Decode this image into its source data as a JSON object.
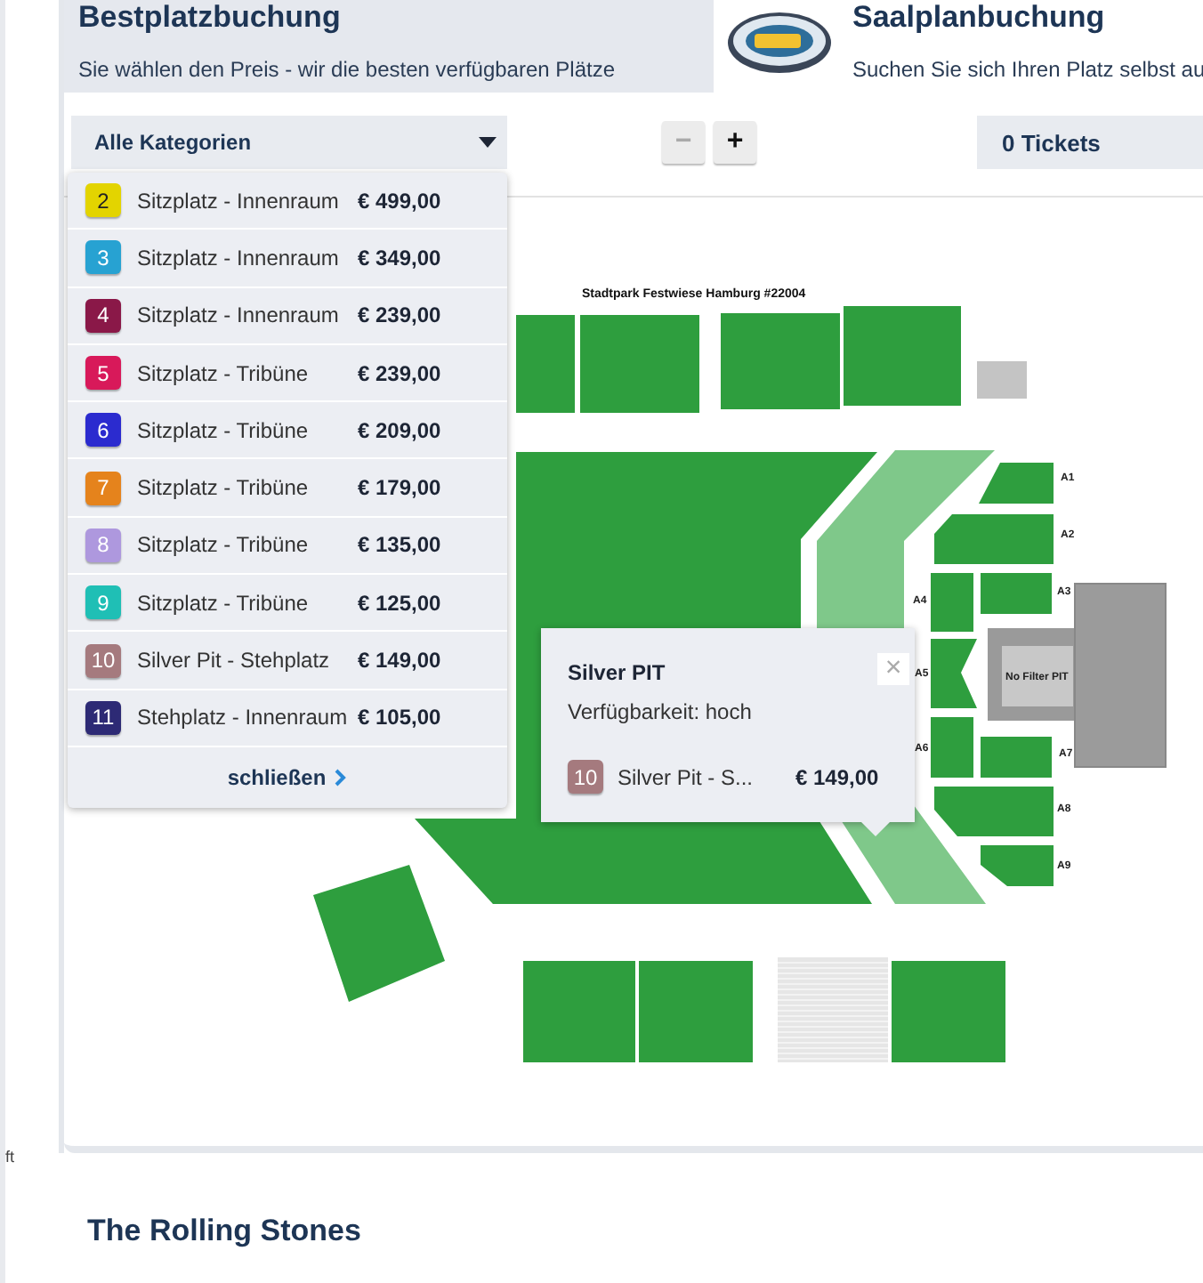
{
  "header": {
    "tabs": [
      {
        "kind": "best",
        "title": "Bestplatzbuchung",
        "subtitle": "Sie wählen den Preis - wir die besten verfügbaren Plätze",
        "selected": true
      },
      {
        "kind": "map",
        "title": "Saalplanbuchung",
        "subtitle": "Suchen Sie sich Ihren Platz selbst au",
        "selected": false
      }
    ]
  },
  "toolbar": {
    "category_select": {
      "value": "Alle Kategorien",
      "expanded": true
    },
    "zoom_buttons": [
      {
        "label": "−",
        "disabled": true
      },
      {
        "label": "+",
        "disabled": false
      }
    ],
    "tickets": "0 Tickets"
  },
  "category_list": {
    "items": [
      {
        "number": "2",
        "name": "Sitzplatz - Innenraum",
        "price": "€ 499,00",
        "color": "#e3d400"
      },
      {
        "number": "3",
        "name": "Sitzplatz - Innenraum",
        "price": "€ 349,00",
        "color": "#27a2d2"
      },
      {
        "number": "4",
        "name": "Sitzplatz - Innenraum",
        "price": "€ 239,00",
        "color": "#8a1848"
      },
      {
        "number": "5",
        "name": "Sitzplatz - Tribüne",
        "price": "€ 239,00",
        "color": "#d8195a"
      },
      {
        "number": "6",
        "name": "Sitzplatz - Tribüne",
        "price": "€ 209,00",
        "color": "#2b2bcf"
      },
      {
        "number": "7",
        "name": "Sitzplatz - Tribüne",
        "price": "€ 179,00",
        "color": "#e5831c"
      },
      {
        "number": "8",
        "name": "Sitzplatz - Tribüne",
        "price": "€ 135,00",
        "color": "#ae98de"
      },
      {
        "number": "9",
        "name": "Sitzplatz - Tribüne",
        "price": "€ 125,00",
        "color": "#1fbfb5"
      },
      {
        "number": "10",
        "name": "Silver Pit - Stehplatz",
        "price": "€ 149,00",
        "color": "#a57a7e"
      },
      {
        "number": "11",
        "name": "Stehplatz - Innenraum",
        "price": "€ 105,00",
        "color": "#2d2a75"
      }
    ],
    "close_link": "schließen"
  },
  "seat_map": {
    "title": "Stadtpark Festwiese Hamburg #22004",
    "section_labels": [
      "A1",
      "A2",
      "A3",
      "A4",
      "A5",
      "A6",
      "A7",
      "A8",
      "A9"
    ],
    "stage_label": "No Filter PIT"
  },
  "popup": {
    "title": "Silver PIT",
    "availability": "Verfügbarkeit: hoch",
    "close": "×",
    "category": {
      "number": "10",
      "name": "Silver Pit - S...",
      "price": "€ 149,00",
      "color": "#a57a7e"
    }
  },
  "event_title": "The Rolling Stones",
  "sidebar_fragment": "ft"
}
